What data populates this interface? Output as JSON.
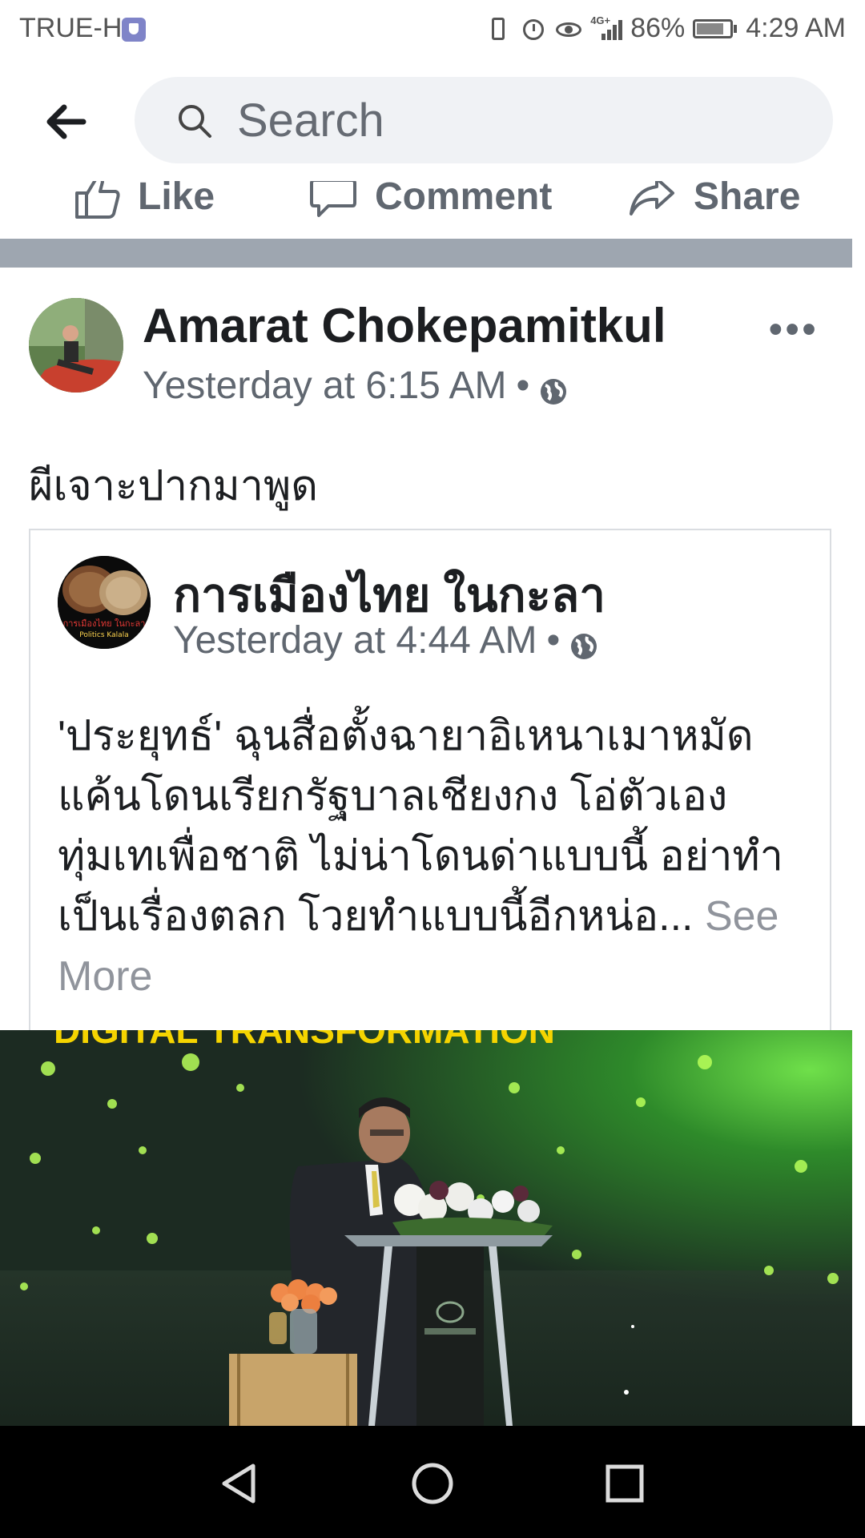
{
  "status_bar": {
    "carrier": "TRUE-H",
    "network": "4G+",
    "battery": "86%",
    "battery_level": 0.86,
    "time": "4:29 AM"
  },
  "search": {
    "placeholder": "Search"
  },
  "actions": {
    "like": "Like",
    "comment": "Comment",
    "share": "Share"
  },
  "post": {
    "author": "Amarat Chokepamitkul",
    "timestamp": "Yesterday at 6:15 AM",
    "separator": "•",
    "text": "ผีเจาะปากมาพูด",
    "more": "•••",
    "shared": {
      "author": "การเมืองไทย ในกะลา",
      "timestamp": "Yesterday at 4:44 AM",
      "separator": "•",
      "avatar_text_top": "การเมืองไทย ในกะลา",
      "avatar_text_bottom": "Politics Kalala",
      "body": "'ประยุทธ์' ฉุนสื่อตั้งฉายาอิเหนาเมาหมัด แค้นโดนเรียกรัฐบาลเชียงกง โอ่ตัวเองทุ่มเทเพื่อชาติ ไม่น่าโดนด่าแบบนี้ อย่าทำเป็นเรื่องตลก โวยทำแบบนี้อีกหน่อ...",
      "see_more": "See More"
    },
    "video_banner": "DIGITAL TRANSFORMATION"
  },
  "colors": {
    "divider": "#9ea6b0",
    "text_primary": "#1c1e21",
    "text_secondary": "#606770",
    "search_bg": "#f0f2f5"
  }
}
